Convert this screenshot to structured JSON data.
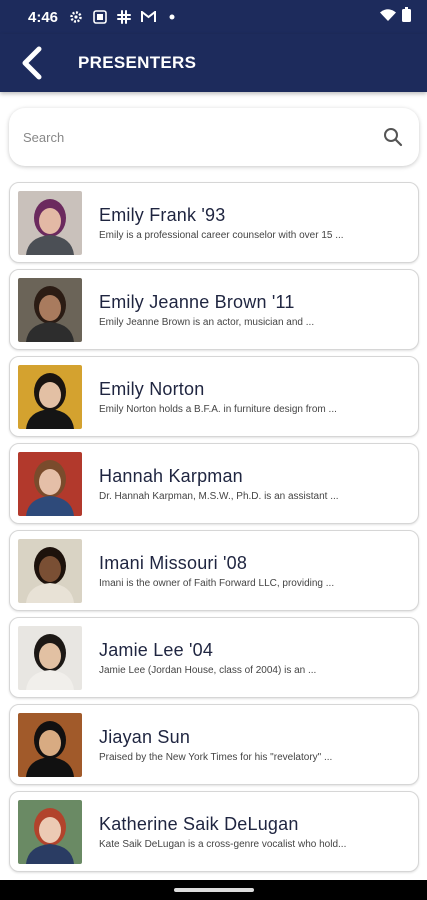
{
  "status": {
    "time": "4:46"
  },
  "header": {
    "title": "PRESENTERS",
    "back_label": "Back"
  },
  "search": {
    "placeholder": "Search",
    "value": ""
  },
  "presenters": [
    {
      "name": "Emily Frank '93",
      "desc": "Emily is a professional career counselor with over 15 ...",
      "bg": "#c9c1bb",
      "hair": "#6b2a5e",
      "skin": "#e3b9a5",
      "shirt": "#4b4f55"
    },
    {
      "name": "Emily Jeanne Brown '11",
      "desc": "Emily Jeanne Brown is an actor, musician and ...",
      "bg": "#6b6458",
      "hair": "#2b1c14",
      "skin": "#a97b5e",
      "shirt": "#2d2d2d"
    },
    {
      "name": "Emily Norton",
      "desc": "Emily Norton holds a B.F.A. in furniture design from ...",
      "bg": "#d4a22f",
      "hair": "#1a1410",
      "skin": "#e3c0a4",
      "shirt": "#151515"
    },
    {
      "name": "Hannah Karpman",
      "desc": "Dr. Hannah Karpman, M.S.W., Ph.D. is an assistant ...",
      "bg": "#b2392c",
      "hair": "#7a4b2c",
      "skin": "#e5bfa8",
      "shirt": "#2e4a7a"
    },
    {
      "name": "Imani Missouri '08",
      "desc": "Imani is the owner of Faith Forward LLC, providing ...",
      "bg": "#d9d3c4",
      "hair": "#1d120c",
      "skin": "#7a4f34",
      "shirt": "#e8e2d6"
    },
    {
      "name": "Jamie Lee '04",
      "desc": "Jamie Lee (Jordan House, class of 2004) is an ...",
      "bg": "#e8e6e2",
      "hair": "#1c1815",
      "skin": "#e2c1a3",
      "shirt": "#f1efeb"
    },
    {
      "name": "Jiayan Sun",
      "desc": "Praised by the New York Times for his \"revelatory\" ...",
      "bg": "#a15a2a",
      "hair": "#121010",
      "skin": "#d8ab82",
      "shirt": "#111111"
    },
    {
      "name": "Katherine Saik DeLugan",
      "desc": "Kate Saik DeLugan is a cross-genre vocalist who hold...",
      "bg": "#6a8a64",
      "hair": "#b2432c",
      "skin": "#eccab4",
      "shirt": "#2a3c63"
    }
  ]
}
